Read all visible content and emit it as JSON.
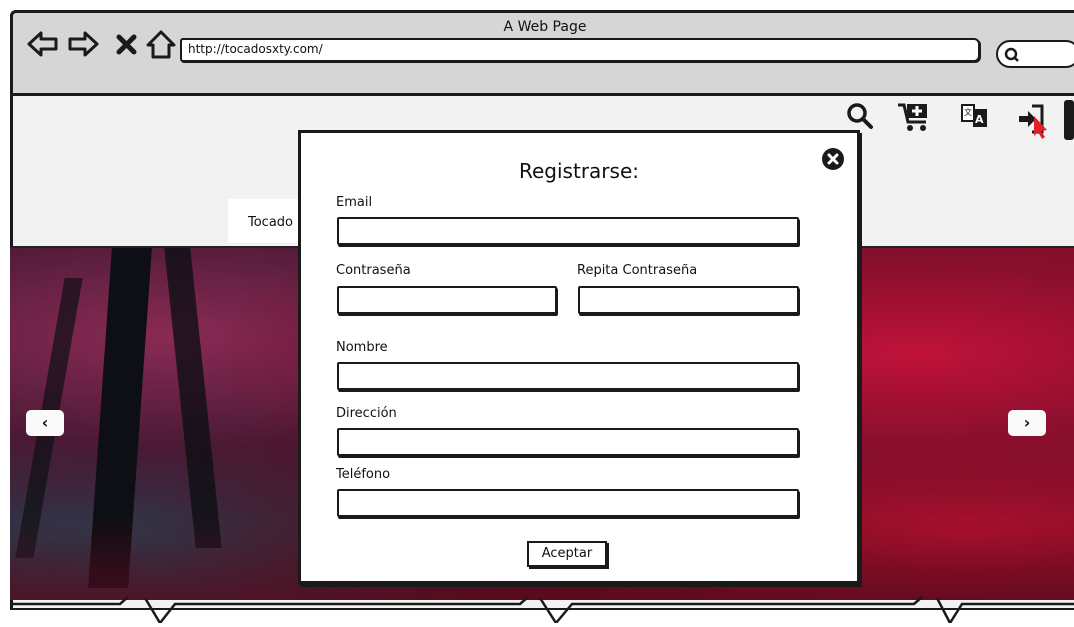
{
  "window": {
    "title": "A Web Page",
    "url": "http://tocadosxty.com/"
  },
  "toolbar": {
    "back_icon": "back-arrow-icon",
    "forward_icon": "forward-arrow-icon",
    "stop_icon": "close-x-icon",
    "home_icon": "home-icon",
    "search_icon": "search-icon"
  },
  "header_icons": [
    "search-icon",
    "cart-add-icon",
    "translate-icon",
    "login-icon"
  ],
  "menu": {
    "tab_label": "Tocado"
  },
  "modal": {
    "title": "Registrarse:",
    "fields": {
      "email_label": "Email",
      "password_label": "Contraseña",
      "password_repeat_label": "Repita Contraseña",
      "name_label": "Nombre",
      "address_label": "Dirección",
      "phone_label": "Teléfono"
    },
    "submit_label": "Aceptar"
  },
  "slider": {
    "prev_icon": "chevron-left-icon",
    "next_icon": "chevron-right-icon"
  },
  "colors": {
    "ink": "#1a1a1a",
    "cursor_red": "#e0202a",
    "forest_red": "#c0123a"
  }
}
